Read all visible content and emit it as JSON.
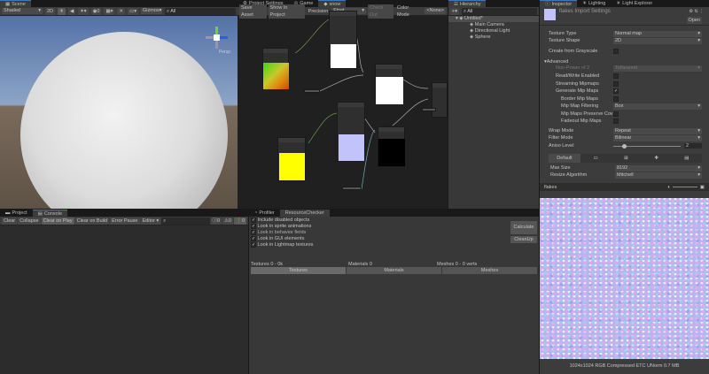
{
  "scene": {
    "tab": "Scene",
    "shading": "Shaded",
    "mode2d": "2D",
    "gizmos": "Gizmos",
    "search": "All",
    "persp": "Persp"
  },
  "graph": {
    "tabs": [
      "Project Settings",
      "Game",
      "snow"
    ],
    "save": "Save Asset",
    "show": "Show In Project",
    "precision_label": "Precision",
    "precision": "Float",
    "checkout": "Check Out",
    "color_mode_label": "Color Mode",
    "color_mode": "<None>"
  },
  "hierarchy": {
    "tab": "Hierarchy",
    "search": "All",
    "scene": "Untitled*",
    "items": [
      "Main Camera",
      "Directional Light",
      "Sphere"
    ]
  },
  "inspector": {
    "tabs": [
      "Inspector",
      "Lighting",
      "Light Explorer"
    ],
    "title": "flakes Import Settings",
    "open": "Open",
    "rows": [
      {
        "label": "Texture Type",
        "value": "Normal map"
      },
      {
        "label": "Texture Shape",
        "value": "2D"
      },
      {
        "label": "Create from Grayscale",
        "check": false
      },
      {
        "label": "Advanced",
        "section": true
      },
      {
        "label": "Non-Power of 2",
        "value": "ToNearest",
        "disabled": true
      },
      {
        "label": "Read/Write Enabled",
        "check": false
      },
      {
        "label": "Streaming Mipmaps",
        "check": false
      },
      {
        "label": "Generate Mip Maps",
        "check": true
      },
      {
        "label": "Border Mip Maps",
        "check": false
      },
      {
        "label": "Mip Map Filtering",
        "value": "Box"
      },
      {
        "label": "Mip Maps Preserve Cov",
        "check": false
      },
      {
        "label": "Fadeout Mip Maps",
        "check": false
      },
      {
        "label": "Wrap Mode",
        "value": "Repeat"
      },
      {
        "label": "Filter Mode",
        "value": "Bilinear"
      },
      {
        "label": "Aniso Level",
        "slider": 2
      }
    ],
    "platform_tab": "Default",
    "max_size_label": "Max Size",
    "max_size": "8192",
    "resize_label": "Resize Algorithm",
    "resize": "Mitchell",
    "preview_name": "flakes",
    "preview_info": "1024x1024  RGB Compressed ETC UNorm   0.7 MB"
  },
  "console": {
    "tabs": [
      "Project",
      "Console"
    ],
    "buttons": [
      "Clear",
      "Collapse",
      "Clear on Play",
      "Clear on Build",
      "Error Pause",
      "Editor ▾"
    ],
    "counts": [
      "0",
      "0",
      "0"
    ]
  },
  "resource": {
    "tabs": [
      "Profiler",
      "ResourceChecker"
    ],
    "options": [
      "Include disabled objects",
      "Look in sprite animations",
      "Look in behavior fields",
      "Look in GUI elements",
      "Look in Lightmap textures"
    ],
    "calculate": "Calculate",
    "cleanup": "CleanUp",
    "textures_stat": "Textures 0 - 0k",
    "materials_stat": "Materials 0",
    "meshes_stat": "Meshes 0 - 0 verts",
    "buttons": [
      "Textures",
      "Materials",
      "Meshes"
    ]
  }
}
